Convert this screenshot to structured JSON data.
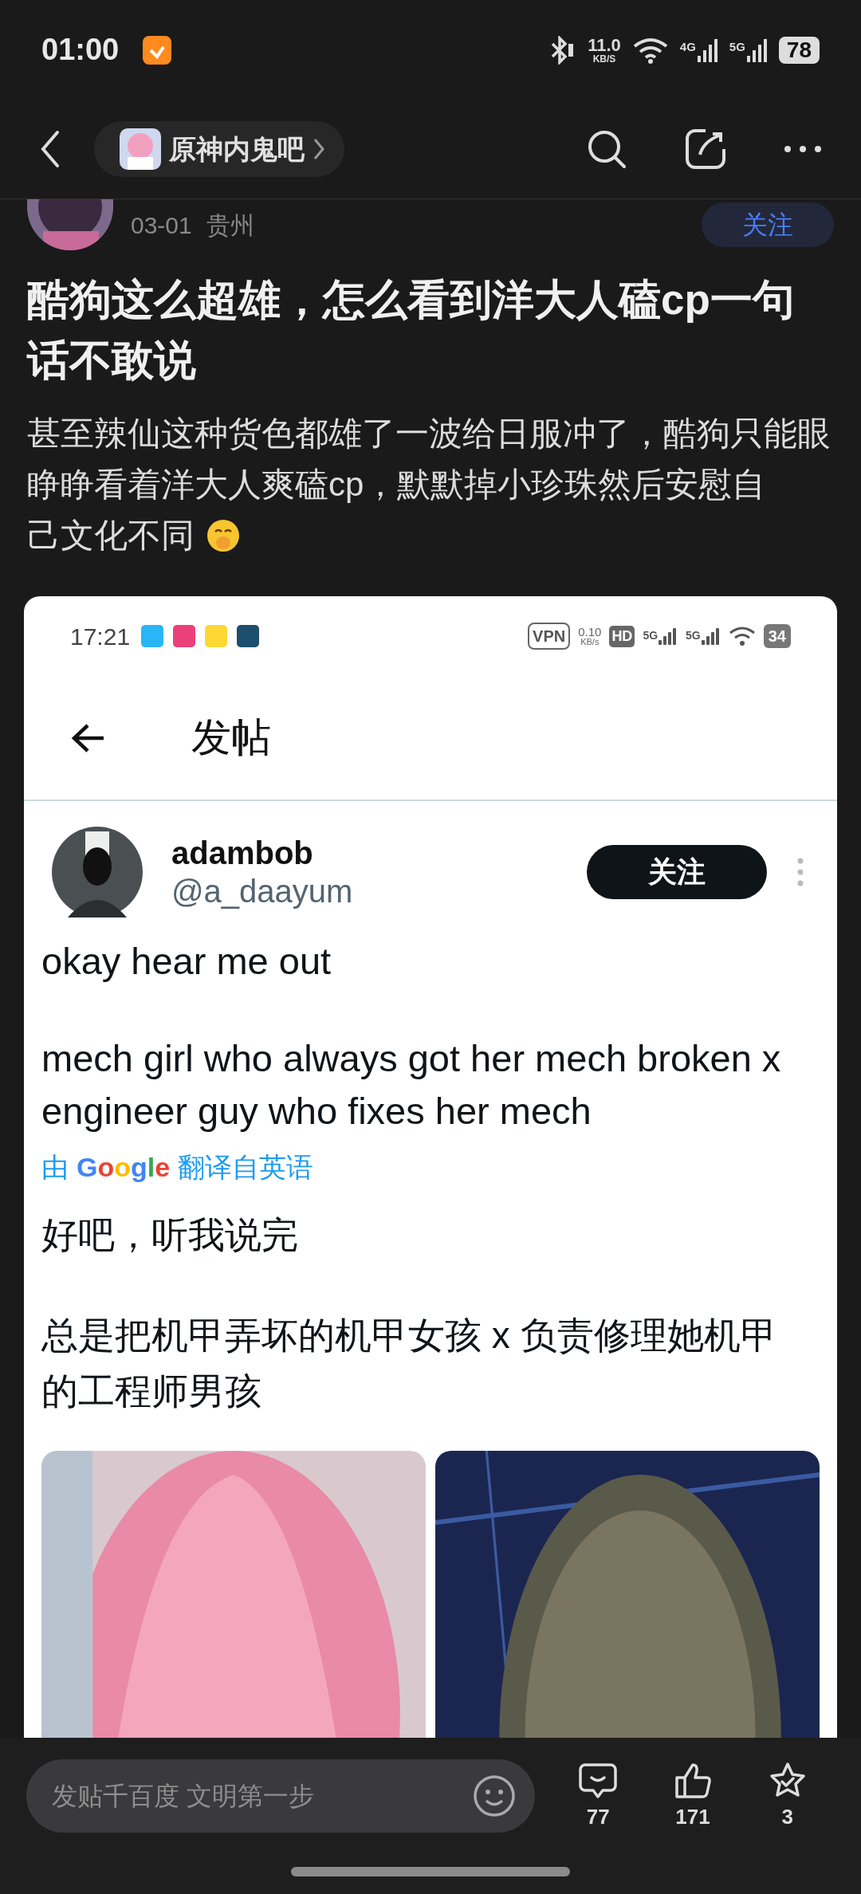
{
  "status_bar": {
    "time": "01:00",
    "speed": "11.0",
    "speed_unit": "KB/S",
    "networks": [
      "4G",
      "5G"
    ],
    "battery": "78"
  },
  "nav": {
    "forum": "原神内鬼吧"
  },
  "author": {
    "date": "03-01",
    "location": "贵州",
    "follow": "关注"
  },
  "post": {
    "title": "酷狗这么超雄，怎么看到洋大人磕cp一句话不敢说",
    "body": "甚至辣仙这种货色都雄了一波给日服冲了，酷狗只能眼睁睁看着洋大人爽磕cp，默默掉小珍珠然后安慰自",
    "body_end": "己文化不同"
  },
  "embed": {
    "status_bar": {
      "time": "17:21",
      "apps": [
        {
          "color": "#29b6f6"
        },
        {
          "color": "#ec407a"
        },
        {
          "color": "#fdd835"
        },
        {
          "color": "#1e4e6e"
        }
      ],
      "vpn": "VPN",
      "speed": "0.10",
      "speed_unit": "KB/s",
      "hd": "HD",
      "networks": [
        "5G",
        "5G"
      ],
      "battery": "34"
    },
    "page_title": "发帖",
    "user": {
      "name": "adambob",
      "handle": "@a_daayum",
      "follow": "关注"
    },
    "paragraphs": [
      "okay hear me out",
      "mech girl who always got her mech broken x engineer guy who fixes her mech"
    ],
    "translation": {
      "prefix": "由",
      "brand": "Google",
      "suffix": "翻译自英语"
    },
    "translated": [
      "好吧，听我说完",
      "总是把机甲弄坏的机甲女孩 x 负责修理她机甲的工程师男孩"
    ],
    "images": [
      {
        "kind": "picture",
        "color": "#e88aa8"
      },
      {
        "kind": "picture",
        "color": "#1c2a5c"
      }
    ]
  },
  "bottom_bar": {
    "placeholder": "发贴千百度 文明第一步",
    "actions": [
      {
        "kind": "comment",
        "count": "77"
      },
      {
        "kind": "like",
        "count": "171"
      },
      {
        "kind": "favorite",
        "count": "3"
      }
    ]
  }
}
